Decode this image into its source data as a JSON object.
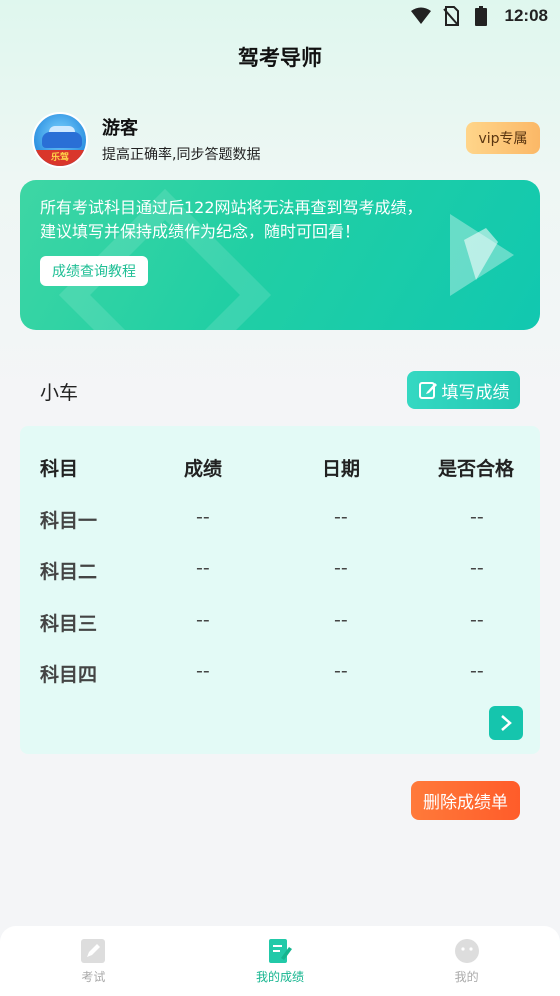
{
  "status_bar": {
    "time": "12:08"
  },
  "app": {
    "title": "驾考导师"
  },
  "user": {
    "name": "游客",
    "subtitle": "提高正确率,同步答题数据",
    "vip_label": "vip专属",
    "avatar_ribbon": "乐驾"
  },
  "banner": {
    "line1": "所有考试科目通过后122网站将无法再查到驾考成绩，",
    "line2": "建议填写并保持成绩作为纪念，随时可回看！",
    "button_label": "成绩查询教程"
  },
  "section": {
    "vehicle_label": "小车",
    "fill_button": "填写成绩"
  },
  "table": {
    "headers": [
      "科目",
      "成绩",
      "日期",
      "是否合格"
    ],
    "rows": [
      {
        "subject": "科目一",
        "score": "--",
        "date": "--",
        "passed": "--"
      },
      {
        "subject": "科目二",
        "score": "--",
        "date": "--",
        "passed": "--"
      },
      {
        "subject": "科目三",
        "score": "--",
        "date": "--",
        "passed": "--"
      },
      {
        "subject": "科目四",
        "score": "--",
        "date": "--",
        "passed": "--"
      }
    ]
  },
  "delete_button": "删除成绩单",
  "bottom_nav": {
    "items": [
      {
        "label": "考试",
        "icon": "pencil-icon",
        "active": false
      },
      {
        "label": "我的成绩",
        "icon": "score-sheet-icon",
        "active": true
      },
      {
        "label": "我的",
        "icon": "face-icon",
        "active": false
      }
    ]
  },
  "colors": {
    "accent": "#21cfa4",
    "delete": "#ff5c2a",
    "vip": "#fbb867",
    "table_bg": "#e3faf6"
  }
}
